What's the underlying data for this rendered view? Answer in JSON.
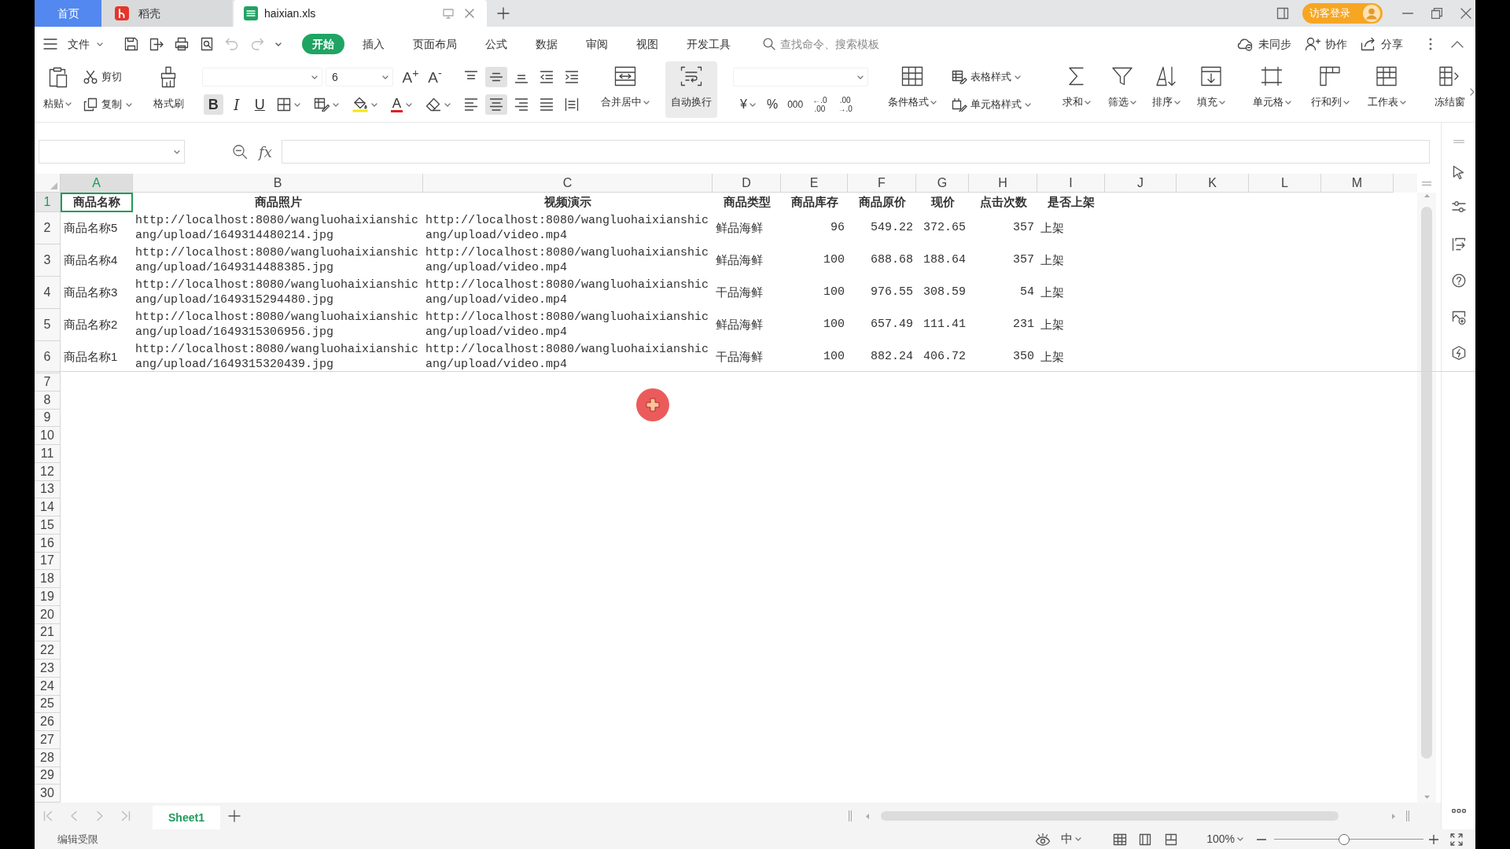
{
  "tabs": [
    {
      "label": "首页",
      "kind": "home",
      "selected": false
    },
    {
      "label": "稻壳",
      "kind": "docer",
      "selected": false
    },
    {
      "label": "haixian.xls",
      "kind": "sheet",
      "selected": true
    }
  ],
  "account": {
    "login": "访客登录"
  },
  "menu": {
    "file": "文件",
    "ribbon_tabs": [
      {
        "label": "开始",
        "selected": true
      },
      {
        "label": "插入",
        "selected": false
      },
      {
        "label": "页面布局",
        "selected": false
      },
      {
        "label": "公式",
        "selected": false
      },
      {
        "label": "数据",
        "selected": false
      },
      {
        "label": "审阅",
        "selected": false
      },
      {
        "label": "视图",
        "selected": false
      },
      {
        "label": "开发工具",
        "selected": false
      }
    ],
    "search": {
      "placeholder": "查找命令、搜索模板"
    },
    "actions": [
      "未同步",
      "协作",
      "分享"
    ]
  },
  "ribbon": {
    "paste": "粘贴",
    "cut": "剪切",
    "copy": "复制",
    "format_painter": "格式刷",
    "font_size": "6",
    "grow_font": "A$^{+}$",
    "shrink_font": "A$^{-}$",
    "bold": {
      "label": "B",
      "on": true
    },
    "italic": {
      "label": "I",
      "on": false
    },
    "underline": {
      "label": "U",
      "on": false
    },
    "font_color": "A",
    "vertical_align": [
      {
        "kind": "top",
        "selected": false
      },
      {
        "kind": "middle",
        "selected": true
      },
      {
        "kind": "bottom",
        "selected": false
      }
    ],
    "horizontal_align": [
      {
        "kind": "left",
        "selected": false
      },
      {
        "kind": "center",
        "selected": true
      },
      {
        "kind": "right",
        "selected": false
      },
      {
        "kind": "justify",
        "selected": false
      },
      {
        "kind": "distributed",
        "selected": false
      }
    ],
    "merge_center": "合并居中",
    "wrap_text": {
      "label": "自动换行",
      "on": true
    },
    "currency": "¥",
    "percent": "%",
    "thousands": "000",
    "increase_decimal": [
      "←.0",
      ".00"
    ],
    "decrease_decimal": [
      ".00",
      "→.0"
    ],
    "conditional_format": "条件格式",
    "styles": [
      "表格样式",
      "单元格样式"
    ],
    "commands": [
      "求和",
      "筛选",
      "排序",
      "填充",
      "单元格",
      "行和列",
      "工作表",
      "冻结窗"
    ]
  },
  "formula_bar": {
    "fx": "fx"
  },
  "sheet": {
    "columns": [
      {
        "label": "A",
        "kind": "text",
        "selected": true
      },
      {
        "label": "B",
        "kind": "url",
        "selected": false
      },
      {
        "label": "C",
        "kind": "url",
        "selected": false
      },
      {
        "label": "D",
        "kind": "text",
        "selected": false
      },
      {
        "label": "E",
        "kind": "number",
        "selected": false
      },
      {
        "label": "F",
        "kind": "number",
        "selected": false
      },
      {
        "label": "G",
        "kind": "number",
        "selected": false
      },
      {
        "label": "H",
        "kind": "number",
        "selected": false
      },
      {
        "label": "I",
        "kind": "text",
        "selected": false
      },
      {
        "label": "J",
        "selected": false
      },
      {
        "label": "K",
        "selected": false
      },
      {
        "label": "L",
        "selected": false
      },
      {
        "label": "M",
        "selected": false
      }
    ],
    "rows": [
      {
        "number": "1",
        "kind": "header",
        "selected": true,
        "cells": [
          {
            "text": "商品名称",
            "selected": true
          },
          {
            "text": "商品照片",
            "selected": false
          },
          {
            "text": "视频演示",
            "selected": false
          },
          {
            "text": "商品类型",
            "selected": false
          },
          {
            "text": "商品库存",
            "selected": false
          },
          {
            "text": "商品原价",
            "selected": false
          },
          {
            "text": "现价",
            "selected": false
          },
          {
            "text": "点击次数",
            "selected": false
          },
          {
            "text": "是否上架",
            "selected": false
          }
        ]
      },
      {
        "number": "2",
        "kind": "data",
        "selected": false,
        "cells": [
          {
            "text": "商品名称5",
            "selected": false
          },
          {
            "text": "http://localhost:8080/wangluohaixianshicang/upload/1649314480214.jpg",
            "selected": false
          },
          {
            "text": "http://localhost:8080/wangluohaixianshicang/upload/video.mp4",
            "selected": false
          },
          {
            "text": "鲜品海鲜",
            "selected": false
          },
          {
            "text": "96",
            "selected": false
          },
          {
            "text": "549.22",
            "selected": false
          },
          {
            "text": "372.65",
            "selected": false
          },
          {
            "text": "357",
            "selected": false
          },
          {
            "text": "上架",
            "selected": false
          }
        ]
      },
      {
        "number": "3",
        "kind": "data",
        "selected": false,
        "cells": [
          {
            "text": "商品名称4",
            "selected": false
          },
          {
            "text": "http://localhost:8080/wangluohaixianshicang/upload/1649314488385.jpg",
            "selected": false
          },
          {
            "text": "http://localhost:8080/wangluohaixianshicang/upload/video.mp4",
            "selected": false
          },
          {
            "text": "鲜品海鲜",
            "selected": false
          },
          {
            "text": "100",
            "selected": false
          },
          {
            "text": "688.68",
            "selected": false
          },
          {
            "text": "188.64",
            "selected": false
          },
          {
            "text": "357",
            "selected": false
          },
          {
            "text": "上架",
            "selected": false
          }
        ]
      },
      {
        "number": "4",
        "kind": "data",
        "selected": false,
        "cells": [
          {
            "text": "商品名称3",
            "selected": false
          },
          {
            "text": "http://localhost:8080/wangluohaixianshicang/upload/1649315294480.jpg",
            "selected": false
          },
          {
            "text": "http://localhost:8080/wangluohaixianshicang/upload/video.mp4",
            "selected": false
          },
          {
            "text": "干品海鲜",
            "selected": false
          },
          {
            "text": "100",
            "selected": false
          },
          {
            "text": "976.55",
            "selected": false
          },
          {
            "text": "308.59",
            "selected": false
          },
          {
            "text": "54",
            "selected": false
          },
          {
            "text": "上架",
            "selected": false
          }
        ]
      },
      {
        "number": "5",
        "kind": "data",
        "selected": false,
        "cells": [
          {
            "text": "商品名称2",
            "selected": false
          },
          {
            "text": "http://localhost:8080/wangluohaixianshicang/upload/1649315306956.jpg",
            "selected": false
          },
          {
            "text": "http://localhost:8080/wangluohaixianshicang/upload/video.mp4",
            "selected": false
          },
          {
            "text": "鲜品海鲜",
            "selected": false
          },
          {
            "text": "100",
            "selected": false
          },
          {
            "text": "657.49",
            "selected": false
          },
          {
            "text": "111.41",
            "selected": false
          },
          {
            "text": "231",
            "selected": false
          },
          {
            "text": "上架",
            "selected": false
          }
        ]
      },
      {
        "number": "6",
        "kind": "data",
        "selected": false,
        "cells": [
          {
            "text": "商品名称1",
            "selected": false
          },
          {
            "text": "http://localhost:8080/wangluohaixianshicang/upload/1649315320439.jpg",
            "selected": false
          },
          {
            "text": "http://localhost:8080/wangluohaixianshicang/upload/video.mp4",
            "selected": false
          },
          {
            "text": "干品海鲜",
            "selected": false
          },
          {
            "text": "100",
            "selected": false
          },
          {
            "text": "882.24",
            "selected": false
          },
          {
            "text": "406.72",
            "selected": false
          },
          {
            "text": "350",
            "selected": false
          },
          {
            "text": "上架",
            "selected": false
          }
        ]
      },
      {
        "number": "7",
        "kind": "blank",
        "selected": false
      },
      {
        "number": "8",
        "kind": "blank",
        "selected": false
      },
      {
        "number": "9",
        "kind": "blank",
        "selected": false
      },
      {
        "number": "10",
        "kind": "blank",
        "selected": false
      },
      {
        "number": "11",
        "kind": "blank",
        "selected": false
      },
      {
        "number": "12",
        "kind": "blank",
        "selected": false
      },
      {
        "number": "13",
        "kind": "blank",
        "selected": false
      },
      {
        "number": "14",
        "kind": "blank",
        "selected": false
      },
      {
        "number": "15",
        "kind": "blank",
        "selected": false
      },
      {
        "number": "16",
        "kind": "blank",
        "selected": false
      },
      {
        "number": "17",
        "kind": "blank",
        "selected": false
      },
      {
        "number": "18",
        "kind": "blank",
        "selected": false
      },
      {
        "number": "19",
        "kind": "blank",
        "selected": false
      },
      {
        "number": "20",
        "kind": "blank",
        "selected": false
      },
      {
        "number": "21",
        "kind": "blank",
        "selected": false
      },
      {
        "number": "22",
        "kind": "blank",
        "selected": false
      },
      {
        "number": "23",
        "kind": "blank",
        "selected": false
      },
      {
        "number": "24",
        "kind": "blank",
        "selected": false
      },
      {
        "number": "25",
        "kind": "blank",
        "selected": false
      },
      {
        "number": "26",
        "kind": "blank",
        "selected": false
      },
      {
        "number": "27",
        "kind": "blank",
        "selected": false
      },
      {
        "number": "28",
        "kind": "blank",
        "selected": false
      },
      {
        "number": "29",
        "kind": "blank",
        "selected": false
      },
      {
        "number": "30",
        "kind": "blank",
        "selected": false
      }
    ]
  },
  "sheet_tabs": [
    {
      "label": "Sheet1",
      "selected": true
    }
  ],
  "status_bar": {
    "text": "编辑受限",
    "input_method": "中",
    "zoom": "100%",
    "zoom_slider": {
      "level": 0.47
    }
  }
}
